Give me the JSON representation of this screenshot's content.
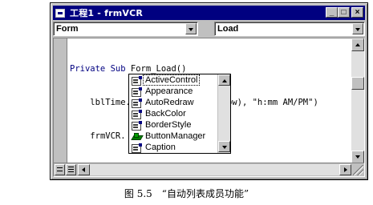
{
  "window": {
    "title": "工程1 - frmVCR",
    "controls": {
      "minimize": "_",
      "maximize": "□",
      "close": "×"
    }
  },
  "object_combo": {
    "value": "Form"
  },
  "procedure_combo": {
    "value": "Load"
  },
  "code_lines": {
    "l1_kw1": "Private",
    "l1_kw2": "Sub",
    "l1_rest": " Form_Load()",
    "l2": "lblTime.Caption = Format((Now), \"h:mm AM/PM\")",
    "l3": "frmVCR."
  },
  "autocomplete": {
    "items": [
      {
        "label": "ActiveControl",
        "icon": "property-icon",
        "selected": true
      },
      {
        "label": "Appearance",
        "icon": "property-icon"
      },
      {
        "label": "AutoRedraw",
        "icon": "property-icon"
      },
      {
        "label": "BackColor",
        "icon": "property-icon"
      },
      {
        "label": "BorderStyle",
        "icon": "property-icon"
      },
      {
        "label": "ButtonManager",
        "icon": "method-icon"
      },
      {
        "label": "Caption",
        "icon": "property-icon"
      }
    ]
  },
  "figure_caption": "图 5.5　“自动列表成员功能”",
  "colors": {
    "titlebar": "#000080",
    "keyword": "#000080",
    "face": "#c0c0c0"
  }
}
